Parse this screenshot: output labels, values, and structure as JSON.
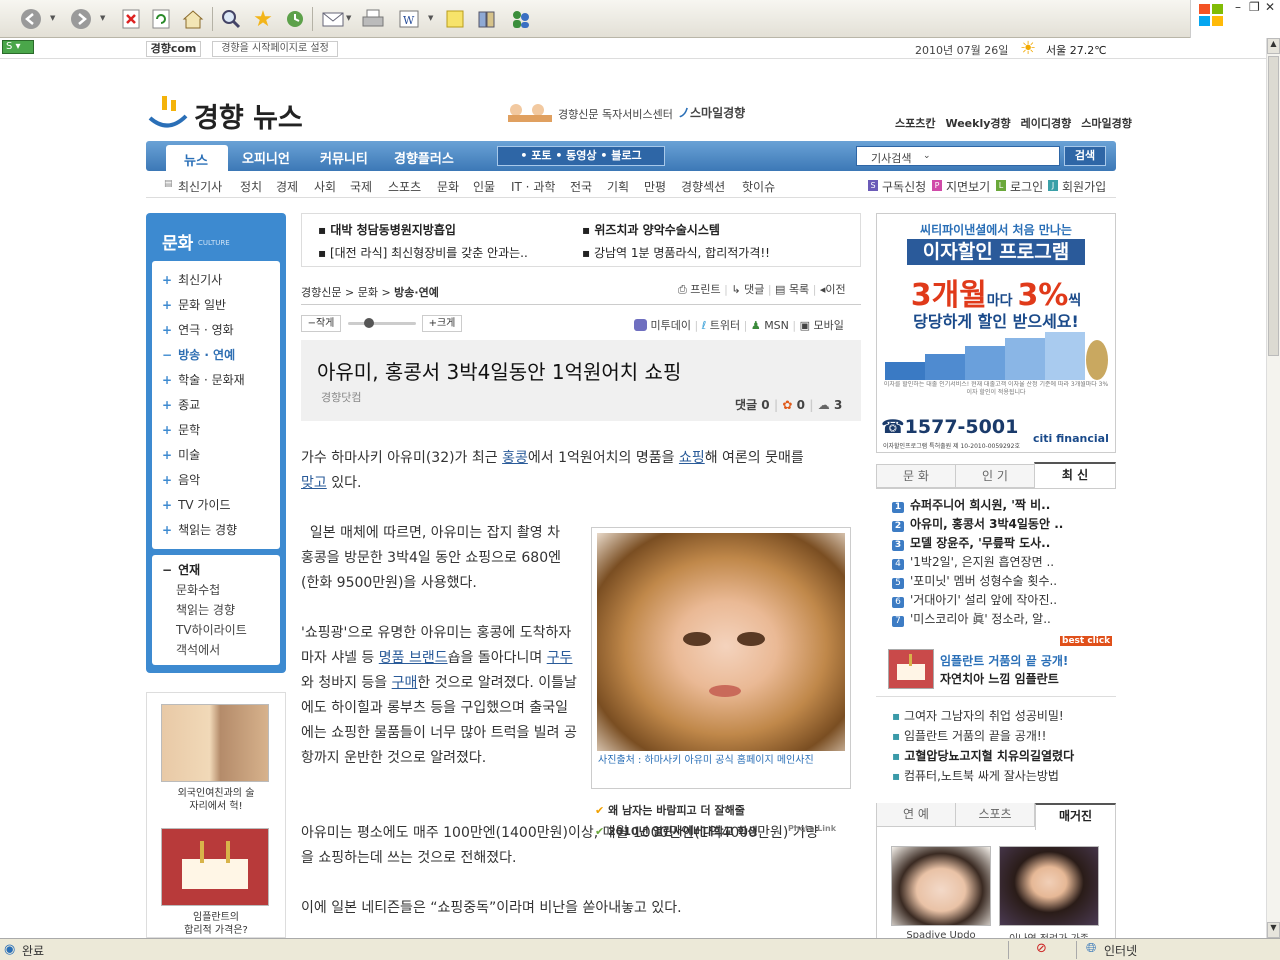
{
  "browser": {
    "status_text": "완료",
    "zone_text": "인터넷"
  },
  "topbar": {
    "logo_text": "경향com",
    "set_home": "경향을 시작페이지로 설정",
    "date": "2010년 07월 26일",
    "weather": "서울  27.2℃"
  },
  "header": {
    "logo": "경향 뉴스",
    "reader_center": "경향신문 독자서비스센터",
    "smile": "스마일경향",
    "family": [
      "스포츠칸",
      "Weekly경향",
      "레이디경향",
      "스마일경향"
    ]
  },
  "nav": {
    "items": [
      "뉴스",
      "오피니언",
      "커뮤니티",
      "경향플러스"
    ],
    "media": "• 포토  • 동영상  • 블로그",
    "search_select": "기사검색",
    "search_button": "검색",
    "sub_items": [
      "최신기사",
      "정치",
      "경제",
      "사회",
      "국제",
      "스포츠",
      "문화",
      "인물",
      "IT · 과학",
      "전국",
      "기획",
      "만평",
      "경향섹션",
      "핫이슈"
    ],
    "util": [
      "구독신청",
      "지면보기",
      "로그인",
      "회원가입"
    ]
  },
  "left": {
    "section_title": "문화",
    "section_sub": "CULTURE",
    "menu": [
      "최신기사",
      "문화 일반",
      "연극 · 영화",
      "방송 · 연예",
      "학술 · 문화재",
      "종교",
      "문학",
      "미술",
      "음악",
      "TV 가이드",
      "책읽는 경향"
    ],
    "series_title": "연재",
    "series": [
      "문화수첩",
      "책읽는 경향",
      "TV하이라이트",
      "객석에서"
    ],
    "ad1_caption": "외국인여친과의 술\n자리에서 헉!",
    "ad2_caption": "임플란트의\n합리적 가격은?"
  },
  "promo": [
    "대박 청담동병원지방흡입",
    "위즈치과 양악수술시스템",
    "[대전 라식] 최신형장비를 갖춘 안과는..",
    "강남역 1분 명품라식, 합리적가격!!"
  ],
  "article": {
    "breadcrumb": [
      "경향신문",
      "문화",
      "방송·연예"
    ],
    "tools": [
      "프린트",
      "댓글",
      "목록",
      "이전"
    ],
    "font_small": "작게",
    "font_large": "크게",
    "share": [
      "미투데이",
      "트위터",
      "MSN",
      "모바일"
    ],
    "title": "아유미, 홍콩서 3박4일동안 1억원어치 쇼핑",
    "source": "경향닷컴",
    "comments_label": "댓글",
    "comments": "0",
    "recommend": "0",
    "shares": "3",
    "p1_a": "가수 하마사키 아유미(32)가 최근 ",
    "p1_l1": "홍콩",
    "p1_b": "에서 1억원어치의 명품을 ",
    "p1_l2": "쇼핑",
    "p1_c": "해 여론의 뭇매를",
    "p1_l3": "맞고",
    "p1_d": " 있다.",
    "p2": "  일본 매체에 따르면, 아유미는 잡지 촬영 차 홍콩을 방문한 3박4일 동안 쇼핑으로 680엔(한화 9500만원)을 사용했다.",
    "p3_a": "'쇼핑광'으로 유명한 아유미는 홍콩에 도착하자마자 샤넬 등 ",
    "p3_l1": "명품 브랜드",
    "p3_b": "숍을 돌아다니며 ",
    "p3_l2": "구두",
    "p3_c": "와 청바지 등을 ",
    "p3_l3": "구매",
    "p3_d": "한 것으로 알려졌다. 이틀날에도 하이힐과 롱부츠 등을 구입했으며 출국일에는 쇼핑한 물품들이 너무 많아 트럭을 빌려 공항까지 운반한 것으로 알려졌다.",
    "p4": "아유미는 평소에도 매주 100만엔(1400만원)이상, 매월 1000만엔(1억4000만원) 가량을 쇼핑하는데 쓰는 것으로 전해졌다.",
    "p5": "이에 일본 네티즌들은 “쇼핑중독”이라며 비난을 쏟아내놓고 있다.",
    "photo_caption": "사진출처 : 하마사키 아유미 공식 홈페이지 메인사진",
    "photo_links": [
      "왜 남자는 바람피고 더 잘해줄",
      "2010년 열린사이버대학교 학생"
    ],
    "photolink_logo": "Photo Link"
  },
  "right": {
    "ad_top": "씨티파이낸셜에서 처음 만나는",
    "ad_prog": "이자할인 프로그램",
    "ad_big1": "3개월",
    "ad_mid": "마다 ",
    "ad_big2": "3%",
    "ad_suffix": "씩",
    "ad_line2": "당당하게 할인 받으세요!",
    "ad_fine": "이자를 할인하는 대출 인기서비스! 현재 대출고객 이자율 산정 기준에 따라 3개월마다 3% 이자 할인이 적용됩니다",
    "ad_phone": "☎1577-5001",
    "ad_brand": "citi financial",
    "ad_reg": "이자할인프로그램 특허출원 제 10-2010-0059292호",
    "tabs": [
      "문 화",
      "인 기",
      "최 신"
    ],
    "news": [
      "슈퍼주니어 희시원, '짝 비..",
      "아유미, 홍콩서 3박4일동안 ..",
      "모델 장윤주, '무릎팍 도사..",
      "'1박2일', 은지원 흡연장면 ..",
      "'포미닛' 멤버 성형수술 횟수..",
      "'거대아기' 설리 앞에 작아진..",
      "'미스코리아 眞' 정소라, 알.."
    ],
    "bestclick": "best click",
    "best_title": "임플란트 거품의 끝 공개!",
    "best_sub": "자연치아 느낌 임플란트",
    "links": [
      "그여자 그남자의 취업 성공비밀!",
      "임플란트 거품의 끝을 공개!!",
      "고혈압당뇨고지혈 치유의길열렸다",
      "컴퓨터,노트북 싸게 잘사는방법"
    ],
    "tabs2": [
      "연 예",
      "스포츠",
      "매거진"
    ],
    "mag_caps": [
      "Spadive Updo",
      "이나영 정려가 가족"
    ]
  }
}
